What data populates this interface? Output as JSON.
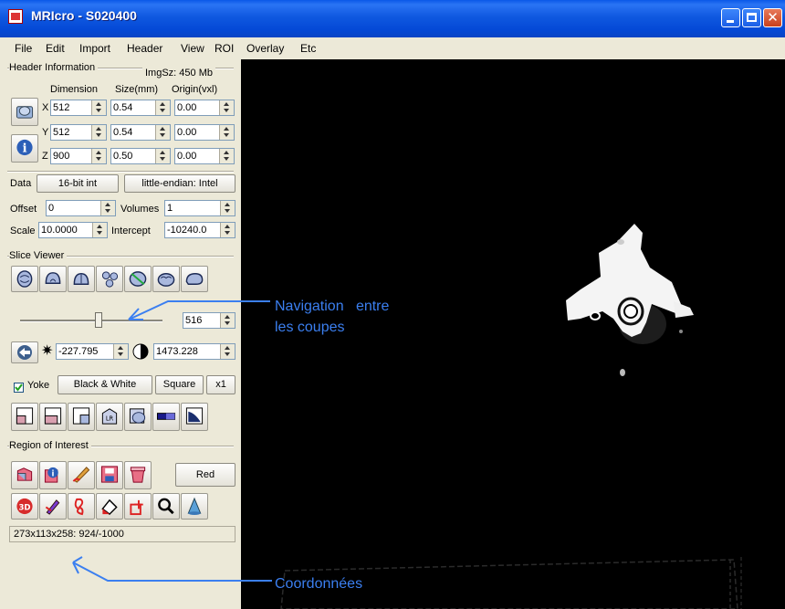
{
  "window": {
    "title": "MRIcro - S020400"
  },
  "menu": [
    "File",
    "Edit",
    "Import",
    "Header",
    "View",
    "ROI",
    "Overlay",
    "Etc"
  ],
  "header_info": {
    "group_label": "Header Information",
    "img_size": "ImgSz: 450 Mb",
    "col_dimension": "Dimension",
    "col_size": "Size(mm)",
    "col_origin": "Origin(vxl)",
    "rows": [
      {
        "axis": "X",
        "dim": "512",
        "size": "0.54",
        "origin": "0.00"
      },
      {
        "axis": "Y",
        "dim": "512",
        "size": "0.54",
        "origin": "0.00"
      },
      {
        "axis": "Z",
        "dim": "900",
        "size": "0.50",
        "origin": "0.00"
      }
    ],
    "data_label": "Data",
    "data_type_button": "16-bit int",
    "endian_button": "little-endian: Intel",
    "offset_label": "Offset",
    "offset_value": "0",
    "volumes_label": "Volumes",
    "volumes_value": "1",
    "scale_label": "Scale",
    "scale_value": "10.0000",
    "intercept_label": "Intercept",
    "intercept_value": "-10240.0"
  },
  "slice_viewer": {
    "group_label": "Slice Viewer",
    "slice_value": "516",
    "slider_fraction": 0.55,
    "brightness_value": "-227.795",
    "contrast_value": "1473.228",
    "yoke_label": "Yoke",
    "yoke_checked": true,
    "bw_button": "Black & White",
    "square_button": "Square",
    "zoom_button": "x1"
  },
  "roi": {
    "group_label": "Region of Interest",
    "color_button": "Red"
  },
  "status": {
    "coords": "273x113x258: 924/-1000"
  },
  "annotations": {
    "nav_line1": "Navigation   entre",
    "nav_line2": "les coupes",
    "coords_label": "Coordonnées"
  },
  "colors": {
    "annotation": "#3b7ff0",
    "titlebar": "#0a58e8",
    "panel": "#ece9d8"
  }
}
